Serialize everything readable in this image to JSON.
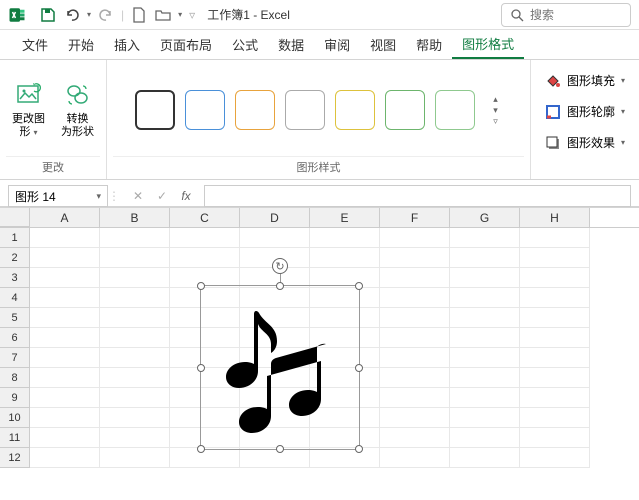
{
  "title": "工作簿1 - Excel",
  "search": {
    "placeholder": "搜索"
  },
  "tabs": [
    "文件",
    "开始",
    "插入",
    "页面布局",
    "公式",
    "数据",
    "审阅",
    "视图",
    "帮助",
    "图形格式"
  ],
  "active_tab": 9,
  "ribbon": {
    "group_change": {
      "label": "更改",
      "change_graphic": "更改图\n形",
      "convert": "转换\n为形状"
    },
    "group_styles": {
      "label": "图形样式"
    },
    "side": {
      "fill": "图形填充",
      "outline": "图形轮廓",
      "effects": "图形效果"
    }
  },
  "name_box": "图形 14",
  "columns": [
    "A",
    "B",
    "C",
    "D",
    "E",
    "F",
    "G",
    "H"
  ],
  "rows": [
    "1",
    "2",
    "3",
    "4",
    "5",
    "6",
    "7",
    "8",
    "9",
    "10",
    "11",
    "12"
  ],
  "shape": {
    "name": "music-notes-icon"
  }
}
